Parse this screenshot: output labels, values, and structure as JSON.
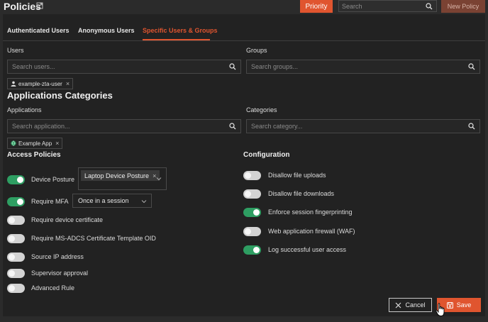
{
  "header": {
    "title": "Policies",
    "priority_label": "Priority",
    "search_placeholder": "Search",
    "new_policy_label": "New Policy"
  },
  "tabs": [
    {
      "label": "Authenticated Users",
      "active": false
    },
    {
      "label": "Anonymous Users",
      "active": false
    },
    {
      "label": "Specific Users & Groups",
      "active": true
    }
  ],
  "users": {
    "label": "Users",
    "placeholder": "Search users...",
    "chips": [
      "example-zta-user"
    ]
  },
  "groups": {
    "label": "Groups",
    "placeholder": "Search groups..."
  },
  "applications_categories": {
    "heading": "Applications Categories",
    "applications_label": "Applications",
    "applications_placeholder": "Search application...",
    "application_chips": [
      "Example App"
    ],
    "categories_label": "Categories",
    "categories_placeholder": "Search category..."
  },
  "access_policies": {
    "heading": "Access Policies",
    "items": [
      {
        "label": "Device Posture",
        "on": true
      },
      {
        "label": "Require MFA",
        "on": true
      },
      {
        "label": "Require device certificate",
        "on": false
      },
      {
        "label": "Require MS-ADCS Certificate Template OID",
        "on": false
      },
      {
        "label": "Source IP address",
        "on": false
      },
      {
        "label": "Supervisor approval",
        "on": false
      },
      {
        "label": "Advanced Rule",
        "on": false
      }
    ],
    "device_posture_value": "Laptop Device Posture",
    "mfa_value": "Once in a session"
  },
  "configuration": {
    "heading": "Configuration",
    "items": [
      {
        "label": "Disallow file uploads",
        "on": false
      },
      {
        "label": "Disallow file downloads",
        "on": false
      },
      {
        "label": "Enforce session fingerprinting",
        "on": true
      },
      {
        "label": "Web application firewall (WAF)",
        "on": false
      },
      {
        "label": "Log successful user access",
        "on": true
      }
    ]
  },
  "footer": {
    "cancel_label": "Cancel",
    "save_label": "Save"
  },
  "colors": {
    "accent": "#e0552f",
    "toggle_on": "#2e9e62",
    "panel": "#222222",
    "background": "#2b2b2b"
  }
}
